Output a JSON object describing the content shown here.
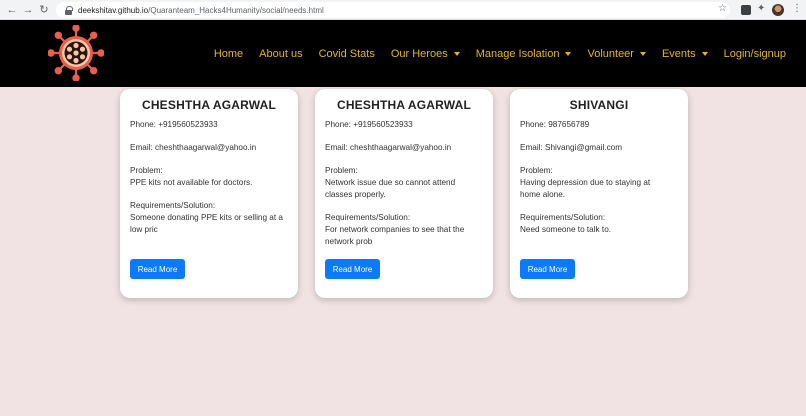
{
  "browser": {
    "url_host": "deekshitav.github.io",
    "url_path": "/Quaranteam_Hacks4Humanity/social/needs.html"
  },
  "navbar": {
    "items": [
      {
        "label": "Home",
        "dropdown": false
      },
      {
        "label": "About us",
        "dropdown": false
      },
      {
        "label": "Covid Stats",
        "dropdown": false
      },
      {
        "label": "Our Heroes",
        "dropdown": true
      },
      {
        "label": "Manage Isolation",
        "dropdown": true
      },
      {
        "label": "Volunteer",
        "dropdown": true
      },
      {
        "label": "Events",
        "dropdown": true
      },
      {
        "label": "Login/signup",
        "dropdown": false
      }
    ],
    "link_color": "#e0b52a",
    "logo_icon": "virus-icon"
  },
  "cards": [
    {
      "name": "CHESHTHA AGARWAL",
      "phone": "Phone: +919560523933",
      "email": "Email: cheshthaagarwal@yahoo.in",
      "problem_label": "Problem:",
      "problem_lines": [
        "PPE kits not available for doctors."
      ],
      "requirements_label": "Requirements/Solution:",
      "requirements_lines": [
        "Someone donating PPE kits or selling at a",
        "low pric"
      ],
      "button": "Read More"
    },
    {
      "name": "CHESHTHA AGARWAL",
      "phone": "Phone: +919560523933",
      "email": "Email: cheshthaagarwal@yahoo.in",
      "problem_label": "Problem:",
      "problem_lines": [
        "Network issue due so cannot attend",
        "classes properly."
      ],
      "requirements_label": "Requirements/Solution:",
      "requirements_lines": [
        "For network companies to see that the",
        "network prob"
      ],
      "button": "Read More"
    },
    {
      "name": "SHIVANGI",
      "phone": "Phone: 987656789",
      "email": "Email: Shivangi@gmail.com",
      "problem_label": "Problem:",
      "problem_lines": [
        "Having depression due to staying at",
        "home alone."
      ],
      "requirements_label": "Requirements/Solution:",
      "requirements_lines": [
        "Need someone to talk to."
      ],
      "button": "Read More"
    }
  ]
}
